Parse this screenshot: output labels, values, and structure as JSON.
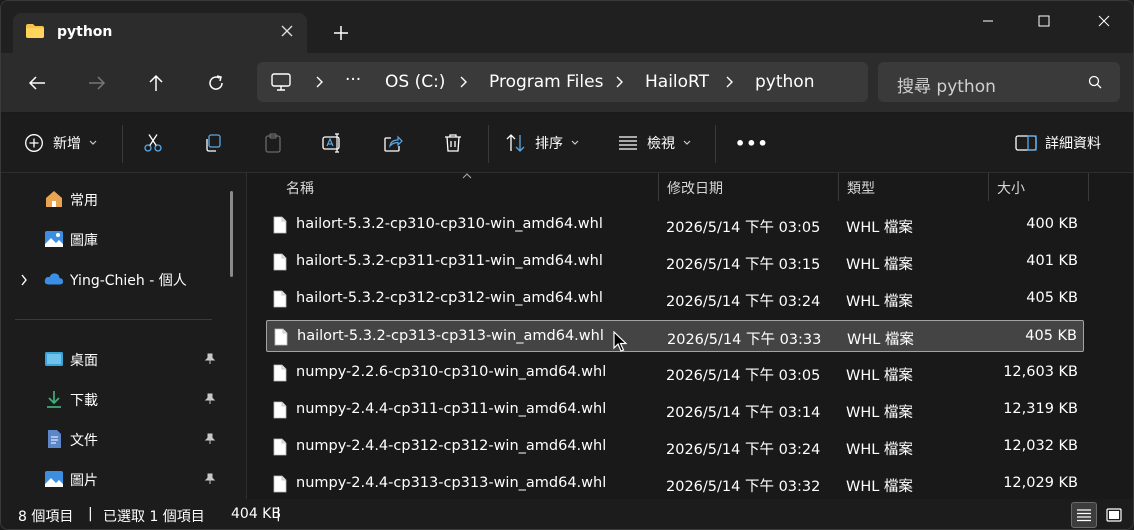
{
  "tab": {
    "title": "python",
    "folder_icon": "folder-icon",
    "close_icon": "close-icon"
  },
  "window_controls": {
    "minimize": "minimize-icon",
    "maximize": "maximize-icon",
    "close": "close-icon"
  },
  "nav": {
    "back": "back-arrow-icon",
    "forward": "forward-arrow-icon",
    "up": "up-arrow-icon",
    "refresh": "refresh-icon",
    "breadcrumb": [
      "OS (C:)",
      "Program Files",
      "HailoRT",
      "python"
    ],
    "overflow": "···",
    "search_placeholder": "搜尋 python"
  },
  "commands": {
    "new_label": "新增",
    "sort_label": "排序",
    "view_label": "檢視",
    "more_label": "•••",
    "details_label": "詳細資料"
  },
  "sidebar": {
    "items": [
      {
        "label": "常用",
        "icon": "home-icon"
      },
      {
        "label": "圖庫",
        "icon": "gallery-icon"
      },
      {
        "label": "Ying-Chieh - 個人",
        "icon": "onedrive-cloud-icon"
      },
      {
        "label": "桌面",
        "icon": "desktop-icon"
      },
      {
        "label": "下載",
        "icon": "download-icon"
      },
      {
        "label": "文件",
        "icon": "documents-icon"
      },
      {
        "label": "圖片",
        "icon": "pictures-icon"
      }
    ]
  },
  "columns": {
    "name": "名稱",
    "date": "修改日期",
    "type": "類型",
    "size": "大小"
  },
  "files": [
    {
      "name": "hailort-5.3.2-cp310-cp310-win_amd64.whl",
      "date": "2026/5/14 下午 03:05",
      "type": "WHL 檔案",
      "size": "400 KB"
    },
    {
      "name": "hailort-5.3.2-cp311-cp311-win_amd64.whl",
      "date": "2026/5/14 下午 03:15",
      "type": "WHL 檔案",
      "size": "401 KB"
    },
    {
      "name": "hailort-5.3.2-cp312-cp312-win_amd64.whl",
      "date": "2026/5/14 下午 03:24",
      "type": "WHL 檔案",
      "size": "405 KB"
    },
    {
      "name": "hailort-5.3.2-cp313-cp313-win_amd64.whl",
      "date": "2026/5/14 下午 03:33",
      "type": "WHL 檔案",
      "size": "405 KB"
    },
    {
      "name": "numpy-2.2.6-cp310-cp310-win_amd64.whl",
      "date": "2026/5/14 下午 03:05",
      "type": "WHL 檔案",
      "size": "12,603 KB"
    },
    {
      "name": "numpy-2.4.4-cp311-cp311-win_amd64.whl",
      "date": "2026/5/14 下午 03:14",
      "type": "WHL 檔案",
      "size": "12,319 KB"
    },
    {
      "name": "numpy-2.4.4-cp312-cp312-win_amd64.whl",
      "date": "2026/5/14 下午 03:24",
      "type": "WHL 檔案",
      "size": "12,032 KB"
    },
    {
      "name": "numpy-2.4.4-cp313-cp313-win_amd64.whl",
      "date": "2026/5/14 下午 03:32",
      "type": "WHL 檔案",
      "size": "12,029 KB"
    }
  ],
  "status": {
    "count": "8 個項目",
    "sep1": "|",
    "selected": "已選取 1 個項目",
    "selected_size": "404 KB",
    "sep2": "|"
  },
  "colors": {
    "background": "#191919",
    "selection": "#444444",
    "accent_folder": "#f8c24a",
    "onedrive": "#3a8ee6"
  }
}
